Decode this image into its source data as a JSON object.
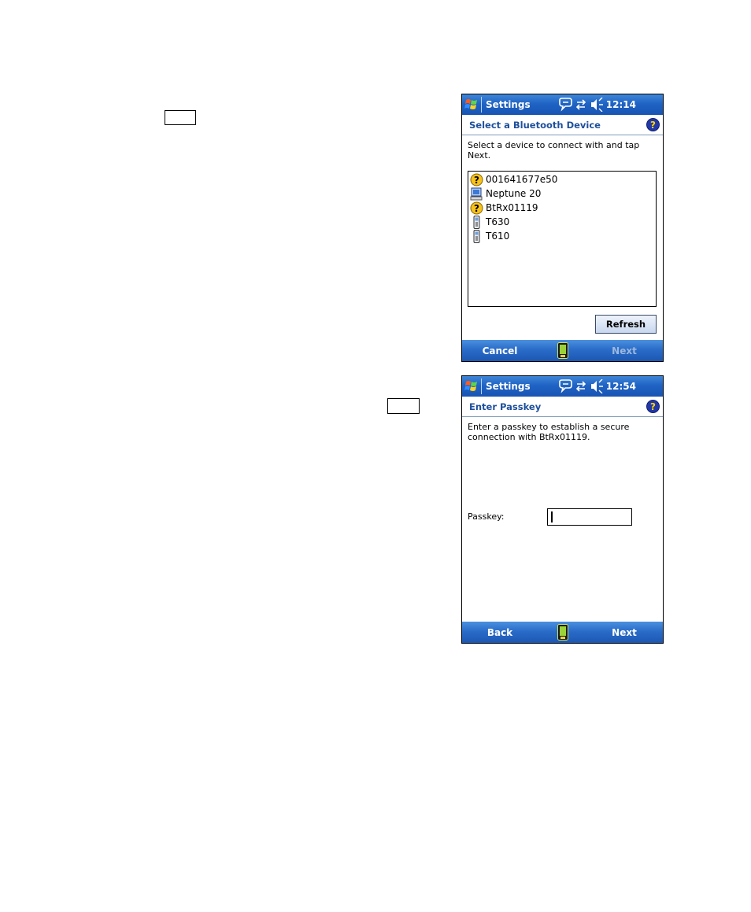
{
  "screens": [
    {
      "titlebar": {
        "title": "Settings",
        "time": "12:14"
      },
      "header": {
        "title": "Select a Bluetooth Device"
      },
      "instruction": "Select a device to connect with and tap Next.",
      "devices": [
        {
          "name": "001641677e50",
          "icon": "unknown-device-icon"
        },
        {
          "name": "Neptune 20",
          "icon": "computer-icon"
        },
        {
          "name": "BtRx01119",
          "icon": "unknown-device-icon"
        },
        {
          "name": "T630",
          "icon": "phone-icon"
        },
        {
          "name": "T610",
          "icon": "phone-icon"
        }
      ],
      "refresh_label": "Refresh",
      "softkeys": {
        "left": "Cancel",
        "right": "Next"
      }
    },
    {
      "titlebar": {
        "title": "Settings",
        "time": "12:54"
      },
      "header": {
        "title": "Enter Passkey"
      },
      "instruction": "Enter a passkey to establish a secure connection with BtRx01119.",
      "passkey_label": "Passkey:",
      "passkey_value": "",
      "softkeys": {
        "left": "Back",
        "right": "Next"
      }
    }
  ],
  "colors": {
    "titlebar": "#1f63c4",
    "header_text": "#1d4f9c",
    "softbar": "#2a6cc9",
    "disabled_softkey": "#9cb8de"
  }
}
